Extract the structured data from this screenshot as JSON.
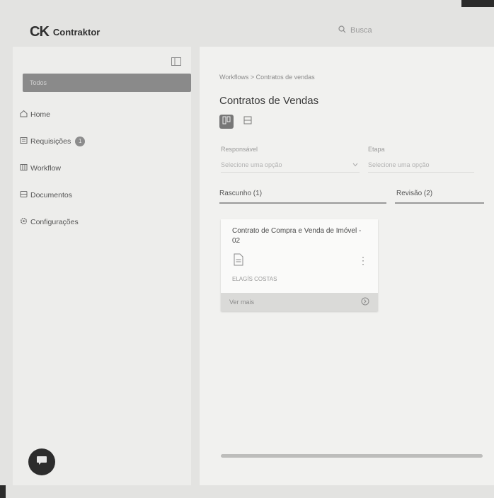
{
  "app": {
    "logo_mark": "CK",
    "name": "Contraktor"
  },
  "search": {
    "placeholder": "Busca"
  },
  "sidebar": {
    "selector_label": "Todos",
    "items": [
      {
        "label": "Home",
        "icon": "home-icon"
      },
      {
        "label": "Requisições",
        "icon": "requests-icon",
        "badge": "1"
      },
      {
        "label": "Workflow",
        "icon": "workflow-icon"
      },
      {
        "label": "Documentos",
        "icon": "documents-icon"
      },
      {
        "label": "Configurações",
        "icon": "settings-icon"
      }
    ]
  },
  "main": {
    "breadcrumb": "Workflows > Contratos de vendas",
    "title": "Contratos de Vendas",
    "filters": {
      "responsavel": {
        "label": "Responsável",
        "placeholder": "Selecione uma opção"
      },
      "etapa": {
        "label": "Etapa",
        "placeholder": "Selecione uma opção"
      }
    },
    "columns": [
      {
        "label": "Rascunho (1)"
      },
      {
        "label": "Revisão (2)"
      }
    ],
    "card": {
      "title": "Contrato de Compra e Venda de Imóvel - 02",
      "meta": "ELAGÍS COSTAS",
      "footer_label": "Ver mais"
    }
  },
  "colors": {
    "accent": "#777777",
    "sidebar_bg": "#ededeb",
    "main_bg": "#f1f1ef"
  }
}
